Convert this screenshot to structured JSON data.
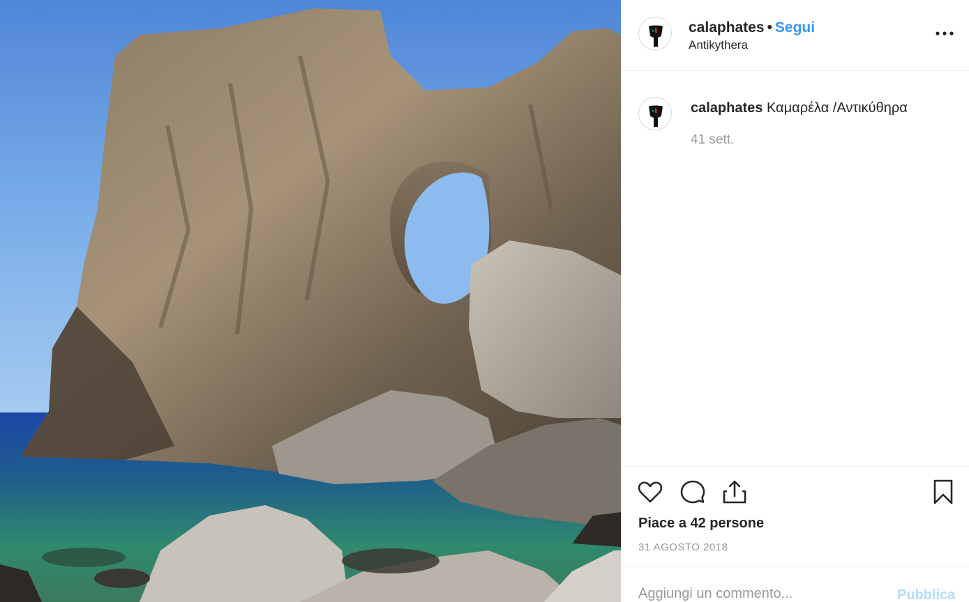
{
  "post": {
    "photo_icon": "photo-of-rock-arch",
    "header": {
      "username": "calaphates",
      "separator": "•",
      "follow_label": "Segui",
      "location": "Antikythera",
      "more_icon": "more-options-icon"
    },
    "caption": {
      "username": "calaphates",
      "text": "Καμαρέλα /Αντικύθηρα",
      "time_ago": "41 sett."
    },
    "actions": {
      "like_icon": "heart-icon",
      "comment_icon": "comment-icon",
      "share_icon": "share-icon",
      "save_icon": "bookmark-icon"
    },
    "likes_text": "Piace a 42 persone",
    "date_text": "31 AGOSTO 2018",
    "comment_box": {
      "placeholder": "Aggiungi un commento...",
      "publish_label": "Pubblica"
    }
  },
  "colors": {
    "link_blue": "#3897f0",
    "publish_disabled": "#b2dffc",
    "secondary_text": "#999999",
    "divider": "#efefef"
  }
}
